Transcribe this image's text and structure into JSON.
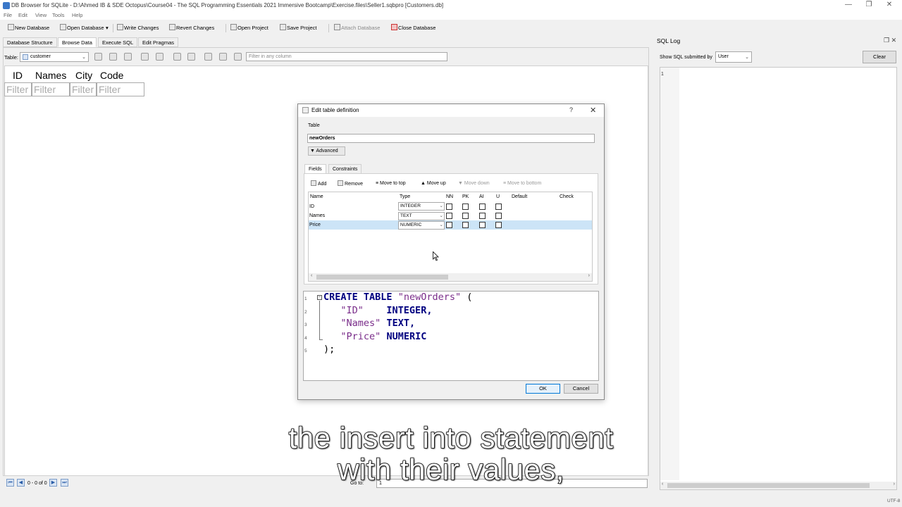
{
  "window": {
    "title": "DB Browser for SQLite - D:\\Ahmed IB & SDE Octopus\\Course04 - The SQL Programming Essentials 2021 Immersive Bootcamp\\Exercise.files\\Seller1.sqbpro [Customers.db]",
    "minimize": "—",
    "restore": "❐",
    "close": "✕"
  },
  "menu": [
    "File",
    "Edit",
    "View",
    "Tools",
    "Help"
  ],
  "toolbar": {
    "new_database": "New Database",
    "open_database": "Open Database",
    "write_changes": "Write Changes",
    "revert_changes": "Revert Changes",
    "open_project": "Open Project",
    "save_project": "Save Project",
    "attach_database": "Attach Database",
    "close_database": "Close Database"
  },
  "tabs": [
    "Database Structure",
    "Browse Data",
    "Execute SQL",
    "Edit Pragmas"
  ],
  "browse": {
    "table_label": "Table:",
    "table_value": "customer",
    "filter_placeholder": "Filter in any column",
    "columns": [
      "ID",
      "Names",
      "City",
      "Code"
    ],
    "filter_text": "Filter",
    "records": "0 - 0 of 0",
    "goto_label": "Go to:",
    "goto_value": "1"
  },
  "sql_log": {
    "title": "SQL Log",
    "show_label": "Show SQL submitted by",
    "submitter": "User",
    "clear": "Clear",
    "line1": "1"
  },
  "status": {
    "encoding": "UTF-8"
  },
  "dialog": {
    "title": "Edit table definition",
    "help": "?",
    "close": "✕",
    "table_label": "Table",
    "table_name": "newOrders",
    "advanced": "Advanced",
    "tabs": [
      "Fields",
      "Constraints"
    ],
    "tools": {
      "add": "Add",
      "remove": "Remove",
      "move_top": "Move to top",
      "move_up": "Move up",
      "move_down": "Move down",
      "move_bottom": "Move to bottom"
    },
    "headers": [
      "Name",
      "Type",
      "NN",
      "PK",
      "AI",
      "U",
      "Default",
      "Check"
    ],
    "fields": [
      {
        "name": "ID",
        "type": "INTEGER"
      },
      {
        "name": "Names",
        "type": "TEXT"
      },
      {
        "name": "Price",
        "type": "NUMERIC"
      }
    ],
    "sql": {
      "line_numbers": [
        "1",
        "2",
        "3",
        "4",
        "5"
      ],
      "create_kw": "CREATE TABLE",
      "table_str": "\"newOrders\"",
      "open_paren": " (",
      "col1": "\"ID\"",
      "col1_type": "INTEGER,",
      "col2": "\"Names\"",
      "col2_type": "TEXT,",
      "col3": "\"Price\"",
      "col3_type": "NUMERIC",
      "close": ");"
    },
    "ok": "OK",
    "cancel": "Cancel"
  },
  "subtitle": {
    "line1": "the insert into statement",
    "line2": "with their values,"
  }
}
